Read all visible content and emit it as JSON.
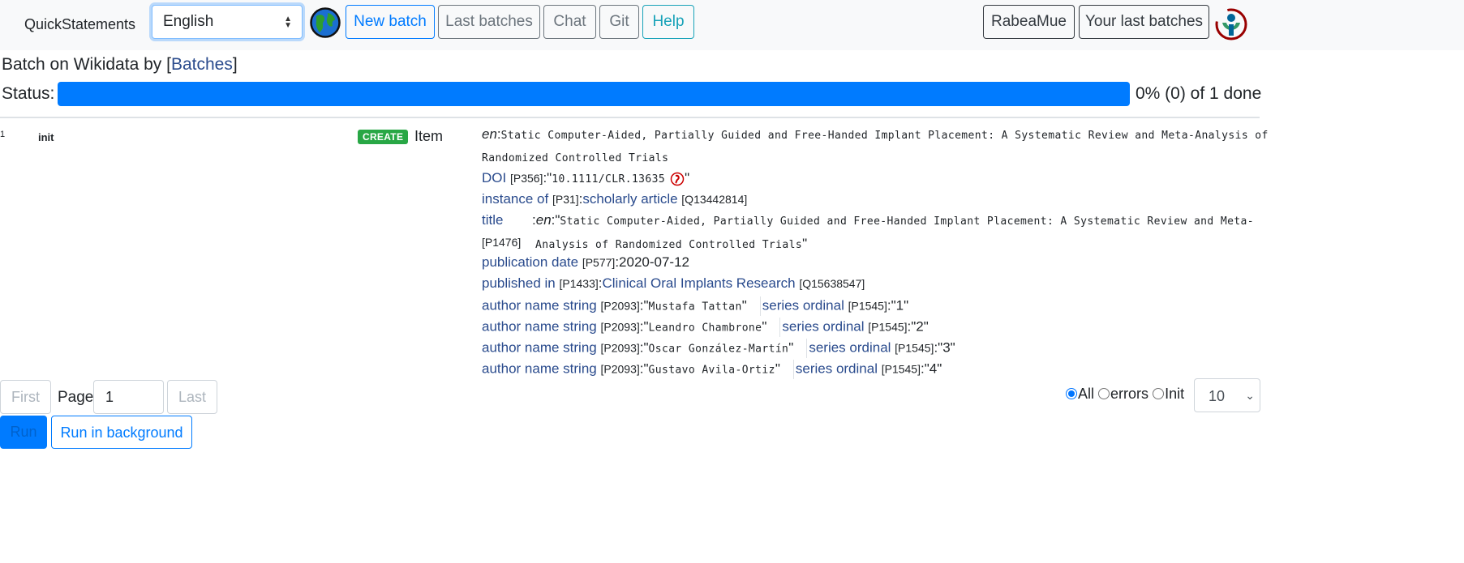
{
  "navbar": {
    "brand": "QuickStatements",
    "language": "English",
    "new_batch": "New batch",
    "last_batches": "Last batches",
    "chat": "Chat",
    "git": "Git",
    "help": "Help",
    "user": "RabeaMue",
    "your_last_batches": "Your last batches"
  },
  "header": {
    "title_prefix": "Batch on Wikidata by [",
    "batches_link": "Batches",
    "title_suffix": "]",
    "status_label": "Status:",
    "progress_text": "0% (0) of 1 done",
    "progress_fraction": 1.0
  },
  "command": {
    "number": "1",
    "status": "init",
    "action": "CREATE",
    "type": "Item",
    "label_lang": "en",
    "label_value": "Static Computer-Aided, Partially Guided and Free-Handed Implant Placement: A Systematic Review and Meta-Analysis of",
    "label_value2": "Randomized Controlled Trials",
    "doi": {
      "prop": "DOI",
      "pid": "[P356]",
      "value": "10.1111/CLR.13635"
    },
    "instance_of": {
      "prop": "instance of",
      "pid": "[P31]",
      "value": "scholarly article",
      "qid": "[Q13442814]"
    },
    "title": {
      "prop": "title",
      "pid": "[P1476]",
      "lang": "en",
      "value1": "Static Computer-Aided, Partially Guided and Free-Handed Implant Placement: A Systematic Review and Meta-",
      "value2": "Analysis of Randomized Controlled Trials"
    },
    "publication_date": {
      "prop": "publication date",
      "pid": "[P577]",
      "value": "2020-07-12"
    },
    "published_in": {
      "prop": "published in",
      "pid": "[P1433]",
      "value": "Clinical Oral Implants Research",
      "qid": "[Q15638547]"
    },
    "authors": [
      {
        "prop": "author name string",
        "pid": "[P2093]",
        "name": "Mustafa Tattan",
        "qual": "series ordinal",
        "qpid": "[P1545]",
        "ord": "1"
      },
      {
        "prop": "author name string",
        "pid": "[P2093]",
        "name": "Leandro Chambrone",
        "qual": "series ordinal",
        "qpid": "[P1545]",
        "ord": "2"
      },
      {
        "prop": "author name string",
        "pid": "[P2093]",
        "name": "Oscar González-Martín",
        "qual": "series ordinal",
        "qpid": "[P1545]",
        "ord": "3"
      },
      {
        "prop": "author name string",
        "pid": "[P2093]",
        "name": "Gustavo Avila-Ortiz",
        "qual": "series ordinal",
        "qpid": "[P1545]",
        "ord": "4"
      }
    ]
  },
  "pagination": {
    "first": "First",
    "page_label": "Page",
    "page_value": "1",
    "last": "Last",
    "run": "Run",
    "run_background": "Run in background",
    "filter_all": "All",
    "filter_errors": "errors",
    "filter_init": "Init",
    "per_page": "10"
  },
  "colors": {
    "primary": "#007bff",
    "link": "#2a4b8d",
    "create_badge": "#28a745"
  },
  "icons": [
    "globe-icon",
    "doi-icon",
    "wikimedia-logo-icon",
    "chevron-down-icon"
  ]
}
